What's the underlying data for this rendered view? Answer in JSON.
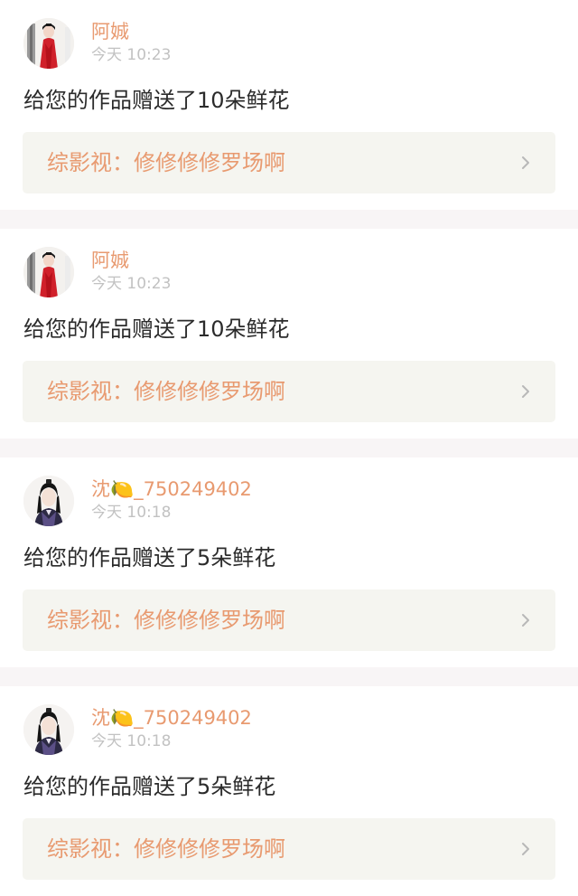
{
  "colors": {
    "accent": "#e89a70",
    "tab_indicator": "#e5739a",
    "separator": "#f8f5f6",
    "link_card_bg": "#f5f5f0",
    "time_text": "#c2c2c2"
  },
  "notifications": [
    {
      "avatar_icon": "avatar-red-robe-icon",
      "username": "阿娍",
      "time": "今天 10:23",
      "message": "给您的作品赠送了10朵鲜花",
      "work_title": "综影视：修修修修罗场啊",
      "chevron_icon": "chevron-right-icon"
    },
    {
      "avatar_icon": "avatar-red-robe-icon",
      "username": "阿娍",
      "time": "今天 10:23",
      "message": "给您的作品赠送了10朵鲜花",
      "work_title": "综影视：修修修修罗场啊",
      "chevron_icon": "chevron-right-icon"
    },
    {
      "avatar_icon": "avatar-dark-robe-icon",
      "username": "沈🍋_750249402",
      "time": "今天 10:18",
      "message": "给您的作品赠送了5朵鲜花",
      "work_title": "综影视：修修修修罗场啊",
      "chevron_icon": "chevron-right-icon"
    },
    {
      "avatar_icon": "avatar-dark-robe-icon",
      "username": "沈🍋_750249402",
      "time": "今天 10:18",
      "message": "给您的作品赠送了5朵鲜花",
      "work_title": "综影视：修修修修罗场啊",
      "chevron_icon": "chevron-right-icon"
    }
  ]
}
